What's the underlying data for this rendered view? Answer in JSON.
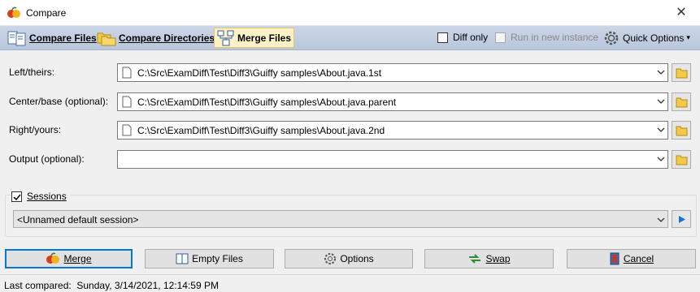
{
  "window": {
    "title": "Compare",
    "close_glyph": "✕"
  },
  "toolbar": {
    "tabs": [
      {
        "label": "Compare Files",
        "icon": "compare-files-icon"
      },
      {
        "label": "Compare Directories",
        "icon": "folders-icon"
      },
      {
        "label": "Merge Files",
        "icon": "merge-files-icon",
        "active": true
      }
    ],
    "diff_only": {
      "label": "Diff only",
      "checked": false
    },
    "run_new_instance": {
      "label": "Run in new instance",
      "checked": false,
      "disabled": true
    },
    "quick_options": {
      "label": "Quick Options",
      "arrow": "▾"
    }
  },
  "fields": {
    "left": {
      "label": "Left/theirs:",
      "value": "C:\\Src\\ExamDiff\\Test\\Diff3\\Guiffy samples\\About.java.1st"
    },
    "center": {
      "label": "Center/base (optional):",
      "value": "C:\\Src\\ExamDiff\\Test\\Diff3\\Guiffy samples\\About.java.parent"
    },
    "right": {
      "label": "Right/yours:",
      "value": "C:\\Src\\ExamDiff\\Test\\Diff3\\Guiffy samples\\About.java.2nd"
    },
    "output": {
      "label": "Output (optional):",
      "value": ""
    }
  },
  "sessions": {
    "label": "Sessions",
    "checked": true,
    "selected": "<Unnamed default session>"
  },
  "buttons": {
    "merge": "Merge",
    "empty": "Empty Files",
    "options": "Options",
    "swap": "Swap",
    "cancel": "Cancel"
  },
  "status": {
    "text": "Last compared:  Sunday, 3/14/2021, 12:14:59 PM"
  },
  "colors": {
    "toolbar_bg": "#c3cfe2",
    "active_tab": "#fdf2c6",
    "accent": "#0078d7"
  }
}
